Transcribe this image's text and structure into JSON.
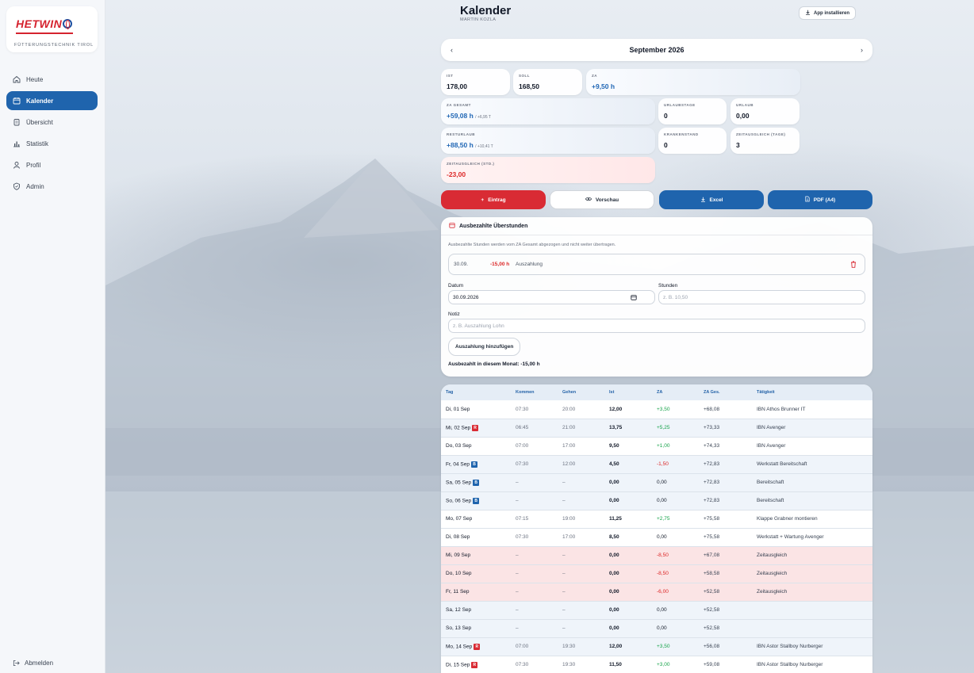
{
  "brand": {
    "logo_text": "HETWIN",
    "subtitle": "FÜTTERUNGSTECHNIK TIROL"
  },
  "nav": {
    "items": [
      {
        "label": "Heute",
        "icon": "home-icon",
        "active": false
      },
      {
        "label": "Kalender",
        "icon": "calendar-icon",
        "active": true
      },
      {
        "label": "Übersicht",
        "icon": "clipboard-icon",
        "active": false
      },
      {
        "label": "Statistik",
        "icon": "bar-chart-icon",
        "active": false
      },
      {
        "label": "Profil",
        "icon": "user-icon",
        "active": false
      },
      {
        "label": "Admin",
        "icon": "shield-icon",
        "active": false
      }
    ],
    "logout": "Abmelden"
  },
  "header": {
    "title": "Kalender",
    "user": "MARTIN KOZLA",
    "install": "App installieren"
  },
  "month": {
    "label": "September 2026",
    "prev": "‹",
    "next": "›"
  },
  "stats": {
    "ist": {
      "label": "IST",
      "value": "178,00"
    },
    "soll": {
      "label": "SOLL",
      "value": "168,50"
    },
    "za": {
      "label": "ZA",
      "value": "+9,50 h"
    },
    "za_gesamt": {
      "label": "ZA GESAMT",
      "value": "+59,08 h",
      "extra": "/ +6,95 T"
    },
    "urlaubstage": {
      "label": "URLAUBSTAGE",
      "value": "0"
    },
    "urlaub": {
      "label": "URLAUB",
      "value": "0,00"
    },
    "resturlaub": {
      "label": "RESTURLAUB",
      "value": "+88,50 h",
      "extra": "/ +10,41 T"
    },
    "krankenstand": {
      "label": "KRANKENSTAND",
      "value": "0"
    },
    "zeitausgleich_tage": {
      "label": "ZEITAUSGLEICH (TAGE)",
      "value": "3"
    },
    "zeitausgleich_std": {
      "label": "ZEITAUSGLEICH (STD.)",
      "value": "-23,00"
    }
  },
  "actions": {
    "entry": "Eintrag",
    "preview": "Vorschau",
    "excel": "Excel",
    "pdf": "PDF (A4)"
  },
  "payout": {
    "title": "Ausbezahlte Überstunden",
    "note": "Ausbezahlte Stunden werden vom ZA Gesamt abgezogen und nicht weiter übertragen.",
    "entry": {
      "date": "30.09.",
      "hours": "-15,00 h",
      "text": "Auszahlung"
    },
    "date_label": "Datum",
    "date_value": "30.09.2026",
    "hours_label": "Stunden",
    "hours_placeholder": "z. B. 10,50",
    "note_label": "Notiz",
    "note_placeholder": "z. B. Auszahlung Lohn",
    "add_button": "Auszahlung hinzufügen",
    "summary": "Ausbezahlt in diesem Monat: -15,00 h"
  },
  "table": {
    "headers": [
      "Tag",
      "Kommen",
      "Gehen",
      "Ist",
      "ZA",
      "ZA Ges.",
      "Tätigkeit"
    ],
    "rows": [
      {
        "tag": "Di, 01 Sep",
        "badge": "",
        "kommen": "07:30",
        "gehen": "20:00",
        "ist": "12,00",
        "za": "+3,50",
        "za_ges": "+68,08",
        "taetigkeit": "IBN Athos Brunner IT",
        "style": "weekday",
        "za_kind": "pos"
      },
      {
        "tag": "Mi, 02 Sep",
        "badge": "r",
        "kommen": "06:45",
        "gehen": "21:00",
        "ist": "13,75",
        "za": "+5,25",
        "za_ges": "+73,33",
        "taetigkeit": "IBN Avenger",
        "style": "alt",
        "za_kind": "pos"
      },
      {
        "tag": "Do, 03 Sep",
        "badge": "",
        "kommen": "07:00",
        "gehen": "17:00",
        "ist": "9,50",
        "za": "+1,00",
        "za_ges": "+74,33",
        "taetigkeit": "IBN Avenger",
        "style": "weekday",
        "za_kind": "pos"
      },
      {
        "tag": "Fr, 04 Sep",
        "badge": "b",
        "kommen": "07:30",
        "gehen": "12:00",
        "ist": "4,50",
        "za": "-1,50",
        "za_ges": "+72,83",
        "taetigkeit": "Werkstatt Bereitschaft",
        "style": "alt",
        "za_kind": "neg"
      },
      {
        "tag": "Sa, 05 Sep",
        "badge": "b",
        "kommen": "–",
        "gehen": "–",
        "ist": "0,00",
        "za": "0,00",
        "za_ges": "+72,83",
        "taetigkeit": "Bereitschaft",
        "style": "alt",
        "za_kind": "zero"
      },
      {
        "tag": "So, 06 Sep",
        "badge": "b",
        "kommen": "–",
        "gehen": "–",
        "ist": "0,00",
        "za": "0,00",
        "za_ges": "+72,83",
        "taetigkeit": "Bereitschaft",
        "style": "alt",
        "za_kind": "zero"
      },
      {
        "tag": "Mo, 07 Sep",
        "badge": "",
        "kommen": "07:15",
        "gehen": "19:00",
        "ist": "11,25",
        "za": "+2,75",
        "za_ges": "+75,58",
        "taetigkeit": "Klappe Grabner montieren",
        "style": "weekday",
        "za_kind": "pos"
      },
      {
        "tag": "Di, 08 Sep",
        "badge": "",
        "kommen": "07:30",
        "gehen": "17:00",
        "ist": "8,50",
        "za": "0,00",
        "za_ges": "+75,58",
        "taetigkeit": "Werkstatt + Wartung Avenger",
        "style": "weekday",
        "za_kind": "zero"
      },
      {
        "tag": "Mi, 09 Sep",
        "badge": "",
        "kommen": "–",
        "gehen": "–",
        "ist": "0,00",
        "za": "-8,50",
        "za_ges": "+67,08",
        "taetigkeit": "Zeitausgleich",
        "style": "za",
        "za_kind": "neg"
      },
      {
        "tag": "Do, 10 Sep",
        "badge": "",
        "kommen": "–",
        "gehen": "–",
        "ist": "0,00",
        "za": "-8,50",
        "za_ges": "+58,58",
        "taetigkeit": "Zeitausgleich",
        "style": "za",
        "za_kind": "neg"
      },
      {
        "tag": "Fr, 11 Sep",
        "badge": "",
        "kommen": "–",
        "gehen": "–",
        "ist": "0,00",
        "za": "-6,00",
        "za_ges": "+52,58",
        "taetigkeit": "Zeitausgleich",
        "style": "za",
        "za_kind": "neg"
      },
      {
        "tag": "Sa, 12 Sep",
        "badge": "",
        "kommen": "–",
        "gehen": "–",
        "ist": "0,00",
        "za": "0,00",
        "za_ges": "+52,58",
        "taetigkeit": "",
        "style": "alt",
        "za_kind": "zero"
      },
      {
        "tag": "So, 13 Sep",
        "badge": "",
        "kommen": "–",
        "gehen": "–",
        "ist": "0,00",
        "za": "0,00",
        "za_ges": "+52,58",
        "taetigkeit": "",
        "style": "alt",
        "za_kind": "zero"
      },
      {
        "tag": "Mo, 14 Sep",
        "badge": "r",
        "kommen": "07:00",
        "gehen": "19:30",
        "ist": "12,00",
        "za": "+3,50",
        "za_ges": "+56,08",
        "taetigkeit": "IBN Astor Stallboy Nurberger",
        "style": "alt",
        "za_kind": "pos"
      },
      {
        "tag": "Di, 15 Sep",
        "badge": "r",
        "kommen": "07:30",
        "gehen": "19:30",
        "ist": "11,50",
        "za": "+3,00",
        "za_ges": "+59,08",
        "taetigkeit": "IBN Astor Stallboy Nurberger",
        "style": "weekday",
        "za_kind": "pos"
      }
    ],
    "badge_letters": {
      "r": "R",
      "b": "B"
    }
  }
}
